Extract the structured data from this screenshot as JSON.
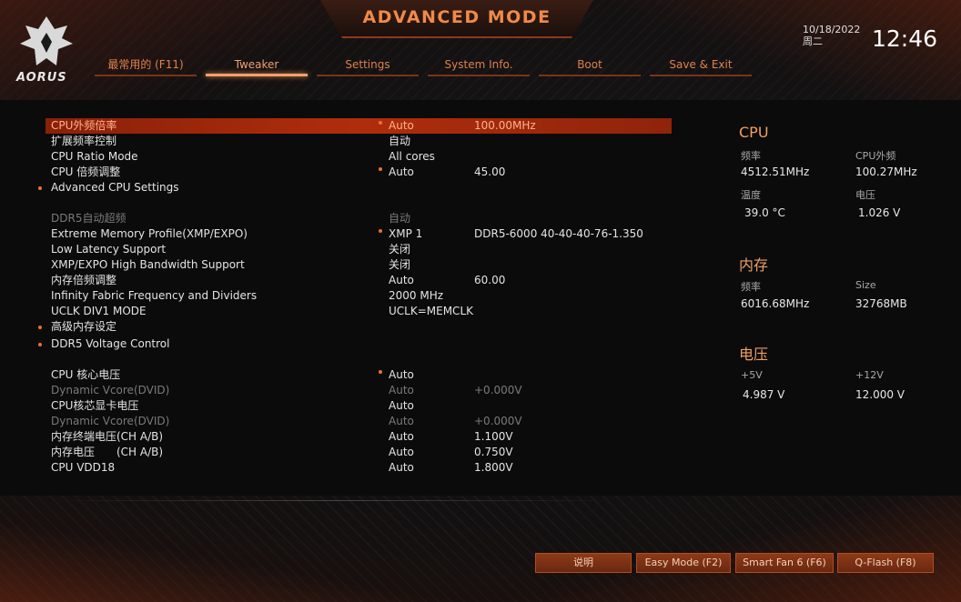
{
  "header": {
    "title": "ADVANCED MODE",
    "logo_text": "AORUS",
    "date": "10/18/2022",
    "weekday": "周二",
    "time": "12:46"
  },
  "tabs": [
    {
      "label": "最常用的 (F11)"
    },
    {
      "label": "Tweaker"
    },
    {
      "label": "Settings"
    },
    {
      "label": "System Info."
    },
    {
      "label": "Boot"
    },
    {
      "label": "Save & Exit"
    }
  ],
  "settings": [
    {
      "label": "CPU外频倍率",
      "value": "Auto",
      "value2": "100.00MHz",
      "highlight": true,
      "vdot": true
    },
    {
      "label": "扩展频率控制",
      "value": "自动",
      "value2": ""
    },
    {
      "label": "CPU Ratio Mode",
      "value": "All cores",
      "value2": ""
    },
    {
      "label": "CPU 倍频调整",
      "value": "Auto",
      "value2": "45.00",
      "vdot": true
    },
    {
      "label": "Advanced CPU Settings",
      "value": "",
      "value2": "",
      "dot": true
    },
    {
      "label": "DDR5自动超频",
      "value": "自动",
      "value2": "",
      "dim": true
    },
    {
      "label": "Extreme Memory Profile(XMP/EXPO)",
      "value": "XMP 1",
      "value2": "DDR5-6000 40-40-40-76-1.350",
      "vdot": true
    },
    {
      "label": "Low Latency Support",
      "value": "关闭",
      "value2": ""
    },
    {
      "label": "XMP/EXPO High Bandwidth Support",
      "value": "关闭",
      "value2": ""
    },
    {
      "label": "内存倍频调整",
      "value": "Auto",
      "value2": "60.00"
    },
    {
      "label": "Infinity Fabric Frequency and Dividers",
      "value": "2000 MHz",
      "value2": ""
    },
    {
      "label": "UCLK DIV1 MODE",
      "value": "UCLK=MEMCLK",
      "value2": ""
    },
    {
      "label": "高级内存设定",
      "value": "",
      "value2": "",
      "dot": true
    },
    {
      "label": "DDR5 Voltage Control",
      "value": "",
      "value2": "",
      "dot": true
    },
    {
      "label": "CPU 核心电压",
      "value": "Auto",
      "value2": "",
      "vdot": true
    },
    {
      "label": "Dynamic Vcore(DVID)",
      "value": "Auto",
      "value2": "+0.000V",
      "dim": true
    },
    {
      "label": "CPU核芯显卡电压",
      "value": "Auto",
      "value2": ""
    },
    {
      "label": "Dynamic Vcore(DVID)",
      "value": "Auto",
      "value2": "+0.000V",
      "dim": true
    },
    {
      "label": "内存终端电压(CH A/B)",
      "value": "Auto",
      "value2": "1.100V"
    },
    {
      "label": "内存电压　　(CH A/B)",
      "value": "Auto",
      "value2": "0.750V"
    },
    {
      "label": "CPU VDD18",
      "value": "Auto",
      "value2": "1.800V"
    }
  ],
  "info": {
    "cpu": {
      "title": "CPU",
      "freq_label": "频率",
      "freq_value": "4512.51MHz",
      "bclk_label": "CPU外频",
      "bclk_value": "100.27MHz",
      "temp_label": "温度",
      "temp_value": "39.0 °C",
      "volt_label": "电压",
      "volt_value": "1.026 V"
    },
    "memory": {
      "title": "内存",
      "freq_label": "频率",
      "freq_value": "6016.68MHz",
      "size_label": "Size",
      "size_value": "32768MB"
    },
    "voltage": {
      "title": "电压",
      "p5_label": "+5V",
      "p5_value": "4.987 V",
      "p12_label": "+12V",
      "p12_value": "12.000 V"
    }
  },
  "buttons": {
    "help": "说明",
    "easy_mode": "Easy Mode (F2)",
    "smart_fan": "Smart Fan 6 (F6)",
    "qflash": "Q-Flash (F8)"
  }
}
